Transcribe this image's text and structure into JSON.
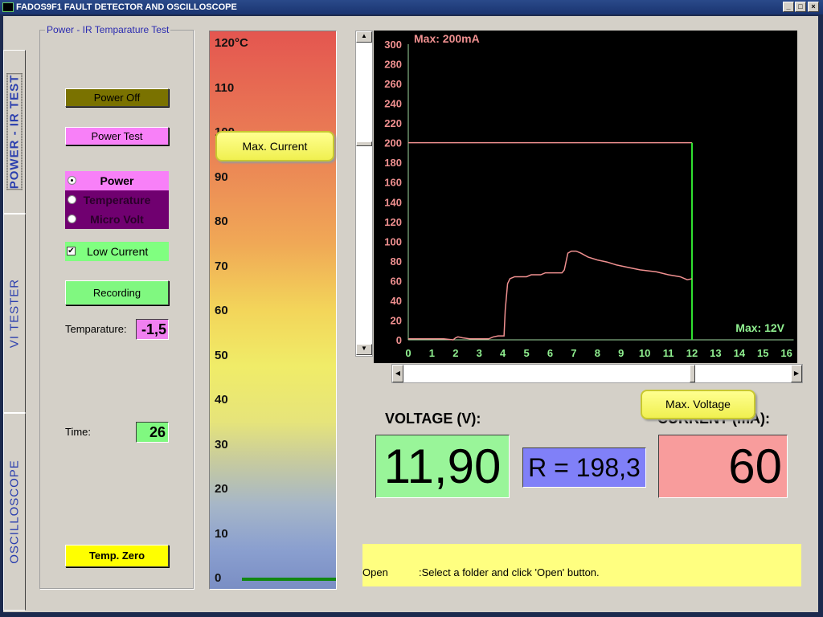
{
  "window": {
    "title": "FADOS9F1   FAULT DETECTOR AND OSCILLOSCOPE",
    "minimize": "_",
    "maximize": "□",
    "close": "×"
  },
  "tabs": [
    {
      "label": "POWER - IR TEST",
      "active": true
    },
    {
      "label": "VI   TESTER"
    },
    {
      "label": "OSCILLOSCOPE"
    }
  ],
  "group": {
    "title": "Power - IR Temparature Test"
  },
  "buttons": {
    "power_off": "Power Off",
    "power_test": "Power Test",
    "recording": "Recording",
    "temp_zero": "Temp. Zero"
  },
  "mode": {
    "options": [
      "Power",
      "Temperature",
      "Micro Volt"
    ],
    "selected": "Power"
  },
  "low_current": {
    "label": "Low Current",
    "checked": true
  },
  "temperature": {
    "label": "Temparature:",
    "value": "-1,5"
  },
  "time": {
    "label": "Time:",
    "value": "26"
  },
  "thermometer": {
    "labels": [
      "120°C",
      "110",
      "100",
      "90",
      "80",
      "70",
      "60",
      "50",
      "40",
      "30",
      "20",
      "10",
      "0"
    ],
    "level_c": 0
  },
  "callouts": {
    "max_current": "Max. Current",
    "max_voltage": "Max. Voltage"
  },
  "readouts": {
    "voltage_label": "VOLTAGE (V):",
    "voltage": "11,90",
    "resistance": "R = 198,3",
    "current_label": "CURRENT (mA):",
    "current": "60"
  },
  "status": {
    "command": "Open",
    "message": ":Select a folder and click 'Open' button."
  },
  "colors": {
    "current": "#f09090",
    "voltage": "#40e040",
    "voltage_box": "#99f599",
    "current_box": "#f89c9c",
    "r_box": "#8080f8",
    "status": "#ffff80"
  },
  "chart_data": {
    "type": "line",
    "xlim": [
      0,
      16
    ],
    "ylim": [
      0,
      300
    ],
    "xticks": [
      "0",
      "1",
      "2",
      "3",
      "4",
      "5",
      "6",
      "7",
      "8",
      "9",
      "10",
      "11",
      "12",
      "13",
      "14",
      "15",
      "16"
    ],
    "yticks": [
      "0",
      "20",
      "40",
      "60",
      "80",
      "100",
      "120",
      "140",
      "160",
      "180",
      "200",
      "220",
      "240",
      "260",
      "280",
      "300"
    ],
    "annotations": {
      "max_current": "Max: 200mA",
      "max_voltage": "Max: 12V"
    },
    "limit_current": 200,
    "limit_voltage": 12,
    "x": [
      0,
      0.5,
      1,
      1.5,
      1.9,
      2,
      2.1,
      2.3,
      2.6,
      3,
      3.4,
      3.6,
      3.8,
      4.05,
      4.1,
      4.2,
      4.3,
      4.5,
      5,
      5.2,
      5.6,
      5.8,
      6.5,
      6.6,
      6.75,
      6.9,
      7.1,
      7.3,
      7.6,
      8,
      8.4,
      8.8,
      9.2,
      9.8,
      10.5,
      11,
      11.5,
      11.8,
      12
    ],
    "values": [
      1,
      1,
      1,
      1,
      0,
      2,
      3,
      2,
      1,
      1,
      1,
      3,
      4,
      4,
      30,
      57,
      62,
      64,
      64,
      66,
      66,
      68,
      68,
      71,
      88,
      90,
      90,
      88,
      84,
      81,
      79,
      76,
      74,
      71,
      69,
      66,
      64,
      61,
      62
    ]
  }
}
